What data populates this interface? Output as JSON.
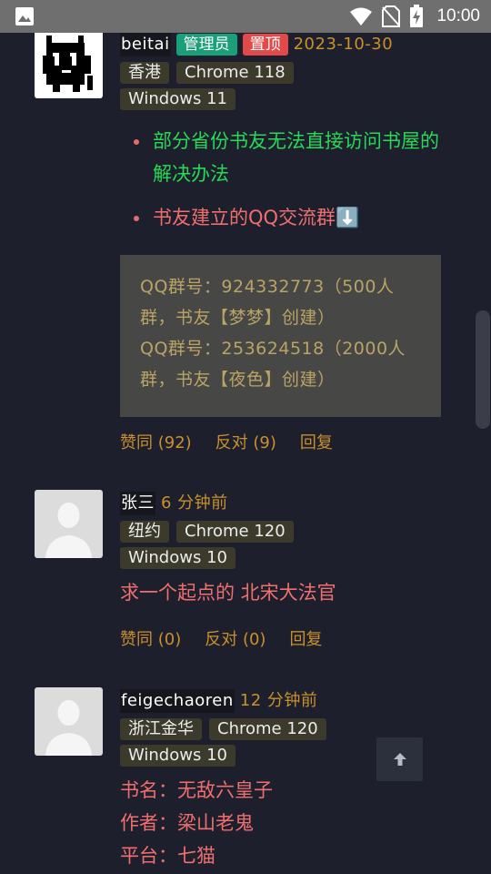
{
  "status_bar": {
    "time": "10:00"
  },
  "comments": [
    {
      "username": "beitai",
      "badges": [
        "管理员",
        "置顶"
      ],
      "time": "2023-10-30",
      "tags": [
        "香港",
        "Chrome 118",
        "Windows 11"
      ],
      "bullets": [
        "部分省份书友无法直接访问书屋的解决办法",
        "书友建立的QQ交流群⬇️"
      ],
      "code_lines": [
        "QQ群号：924332773（500人群，书友【梦梦】创建）",
        "QQ群号：253624518（2000人群，书友【夜色】创建）"
      ],
      "actions": {
        "agree": "赞同 (92)",
        "oppose": "反对 (9)",
        "reply": "回复"
      }
    },
    {
      "username": "张三",
      "time": "6 分钟前",
      "tags": [
        "纽约",
        "Chrome 120",
        "Windows 10"
      ],
      "text": "求一个起点的 北宋大法官",
      "actions": {
        "agree": "赞同 (0)",
        "oppose": "反对 (0)",
        "reply": "回复"
      }
    },
    {
      "username": "feigechaoren",
      "time": "12 分钟前",
      "tags": [
        "浙江金华",
        "Chrome 120",
        "Windows 10"
      ],
      "lines": [
        "书名：无敌六皇子",
        "作者：梁山老鬼",
        "平台：七猫"
      ]
    }
  ],
  "colors": {
    "background": "#1d1f2d",
    "accent_time": "#c9902b",
    "admin_badge": "#19a078",
    "pinned_badge": "#e24a4a",
    "link_green": "#27d957",
    "text_pink": "#ef6f6f"
  },
  "icons": [
    "image-icon",
    "wifi-icon",
    "no-sim-icon",
    "battery-charging-icon",
    "arrow-up-icon"
  ]
}
